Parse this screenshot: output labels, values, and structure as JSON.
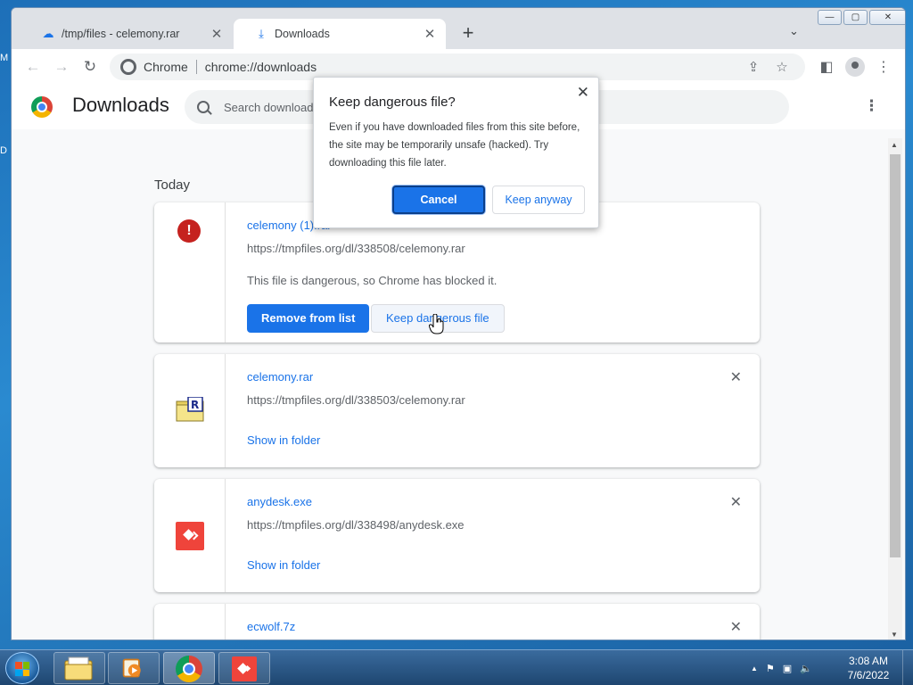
{
  "window": {
    "tabs": [
      {
        "title": "/tmp/files - celemony.rar",
        "icon": "cloud-upload-icon",
        "active": false
      },
      {
        "title": "Downloads",
        "icon": "download-icon",
        "active": true
      }
    ],
    "new_tab": "+",
    "tab_search": "⌄",
    "controls": {
      "minimize": "—",
      "maximize": "▢",
      "close": "✕"
    }
  },
  "toolbar": {
    "back": "←",
    "forward": "→",
    "reload": "↻",
    "site_name": "Chrome",
    "url": "chrome://downloads",
    "share": "⇪",
    "bookmark": "☆",
    "side_panel": "◧",
    "menu": "⋮"
  },
  "page": {
    "title": "Downloads",
    "search_placeholder": "Search downloads",
    "menu": "⋮",
    "section_label": "Today",
    "items": [
      {
        "name": "celemony (1).rar",
        "url": "https://tmpfiles.org/dl/338508/celemony.rar",
        "status": "This file is dangerous, so Chrome has blocked it.",
        "primary_action": "Remove from list",
        "secondary_action": "Keep dangerous file",
        "icon": "danger-icon"
      },
      {
        "name": "celemony.rar",
        "url": "https://tmpfiles.org/dl/338503/celemony.rar",
        "action": "Show in folder",
        "icon": "rar-file-icon"
      },
      {
        "name": "anydesk.exe",
        "url": "https://tmpfiles.org/dl/338498/anydesk.exe",
        "action": "Show in folder",
        "icon": "anydesk-icon"
      },
      {
        "name": "ecwolf.7z",
        "icon": "7z-file-icon"
      }
    ]
  },
  "dialog": {
    "title": "Keep dangerous file?",
    "body": "Even if you have downloaded files from this site before, the site may be temporarily unsafe (hacked). Try downloading this file later.",
    "cancel": "Cancel",
    "keep": "Keep anyway",
    "close": "✕"
  },
  "taskbar": {
    "time": "3:08 AM",
    "date": "7/6/2022",
    "tray_expand": "▲"
  },
  "desktop": {
    "letter_m": "M",
    "letter_d": "D"
  },
  "colors": {
    "accent": "#1a73e8",
    "danger": "#c5221f",
    "anydesk": "#ef443b"
  }
}
